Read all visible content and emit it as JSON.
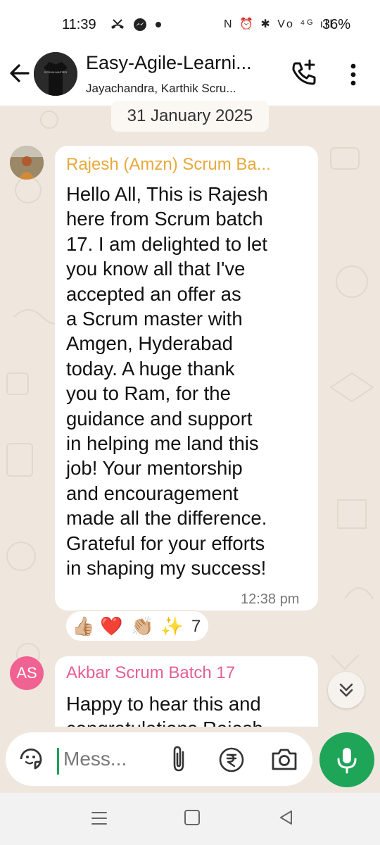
{
  "status_bar": {
    "time": "11:39",
    "left_icons": [
      "missed-call-icon",
      "messenger-icon",
      "dot-icon"
    ],
    "right_icons": [
      "nfc-icon",
      "alarm-icon",
      "bluetooth-icon",
      "volte-icon",
      "4g-signal-icon",
      "signal-icon",
      "battery-icon"
    ],
    "right_icons_glyphs": "N ⏰ ✱ Vo ⁴ᴳ ıll",
    "battery": "36%"
  },
  "header": {
    "title": "Easy-Agile-Learni...",
    "subtitle": "Jayachandra, Karthik Scru...",
    "avatar_text": "SCRUM MASTER"
  },
  "chat": {
    "date_chip": "31 January 2025",
    "messages": [
      {
        "sender": "Rajesh (Amzn) Scrum Ba...",
        "sender_color": "#e7a93b",
        "text": "Hello All, This is Rajesh here from Scrum batch 17. I am delighted to let you know all that I've accepted an offer as a Scrum master with Amgen, Hyderabad today. A huge thank you to Ram, for the guidance and support in helping me land this job! Your mentorship and encouragement made all the difference. Grateful for your efforts in shaping my success!",
        "lines": [
          "Hello All, This is Rajesh",
          "here from Scrum batch",
          "17. I am delighted to let",
          "you know all that I've",
          "accepted an offer as",
          "a Scrum master with",
          "Amgen, Hyderabad",
          "today. A huge thank",
          "you to Ram, for the",
          "guidance and support",
          "in helping me land this",
          "job! Your mentorship",
          "and encouragement",
          "made all the difference.",
          "Grateful for your efforts",
          "in shaping my success!"
        ],
        "time": "12:38 pm",
        "reactions": [
          "👍🏼",
          "❤️",
          "👏🏼",
          "✨"
        ],
        "reaction_count": "7"
      },
      {
        "avatar_initials": "AS",
        "sender": "Akbar Scrum Batch 17",
        "sender_color": "#e45e93",
        "lines": [
          "Happy to hear this and",
          "congratulations Rajesh"
        ]
      }
    ]
  },
  "composer": {
    "placeholder": "Mess..."
  },
  "colors": {
    "accent_green": "#1ea557",
    "chat_bg": "#efe7de"
  }
}
